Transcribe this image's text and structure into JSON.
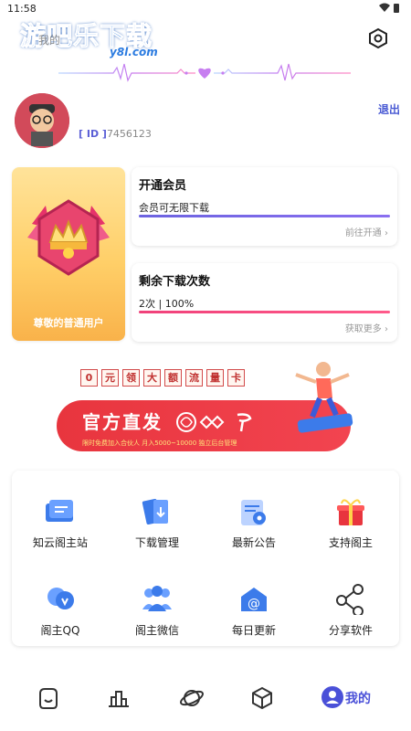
{
  "status_bar": {
    "time": "11:58"
  },
  "header": {
    "logo_text": "游吧乐下载",
    "logo_sub": "y8l.com",
    "title": "我的"
  },
  "profile": {
    "id_tag": "[ ID ]",
    "id_value": "7456123",
    "logout_label": "退出"
  },
  "rank": {
    "label": "尊敬的普通用户"
  },
  "vip_card": {
    "title": "开通会员",
    "desc": "会员可无限下载",
    "link": "前往开通",
    "progress": 1.0,
    "bar_color": "#6c63e0"
  },
  "download_card": {
    "title": "剩余下载次数",
    "desc": "2次 | 100%",
    "link": "获取更多",
    "progress": 1.0,
    "bar_color": "#f0417a"
  },
  "banner": {
    "chips": [
      "0",
      "元",
      "领",
      "大",
      "额",
      "流",
      "量",
      "卡"
    ],
    "main_text": "官方直发",
    "fine_print": "限时免费加入合伙人 月入5000~10000 独立后台管理"
  },
  "grid": [
    {
      "label": "知云阁主站",
      "icon": "website-icon"
    },
    {
      "label": "下载管理",
      "icon": "download-manage-icon"
    },
    {
      "label": "最新公告",
      "icon": "announcement-icon"
    },
    {
      "label": "支持阁主",
      "icon": "gift-icon"
    },
    {
      "label": "阁主QQ",
      "icon": "qq-icon"
    },
    {
      "label": "阁主微信",
      "icon": "wechat-group-icon"
    },
    {
      "label": "每日更新",
      "icon": "email-update-icon"
    },
    {
      "label": "分享软件",
      "icon": "share-icon"
    }
  ],
  "bottom_nav": {
    "items": [
      "home-icon",
      "rank-icon",
      "planet-icon",
      "cube-icon",
      "user-icon"
    ],
    "active_label": "我的"
  },
  "colors": {
    "accent": "#4a50d8",
    "vip_bar": "#6c63e0",
    "download_bar": "#f0417a",
    "banner_red": "#e8353e"
  }
}
